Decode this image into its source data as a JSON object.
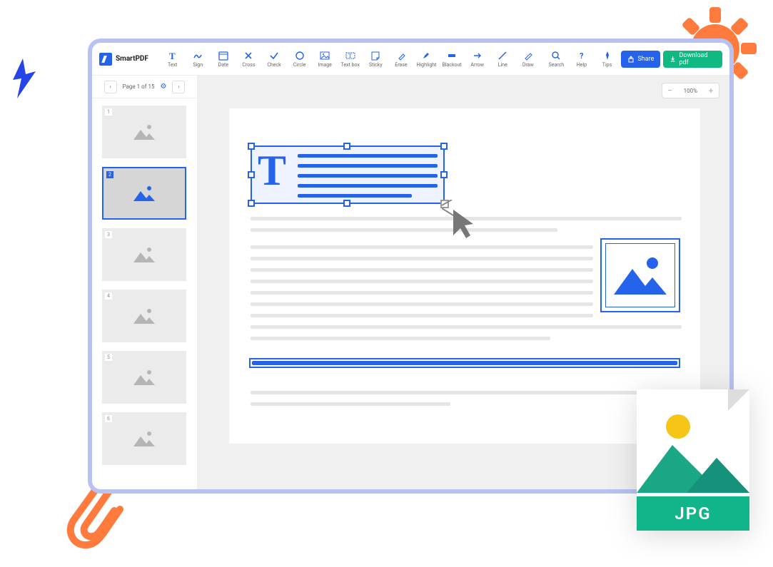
{
  "brand": {
    "name": "SmartPDF"
  },
  "toolbar": {
    "items": [
      {
        "label": "Text"
      },
      {
        "label": "Sign"
      },
      {
        "label": "Date"
      },
      {
        "label": "Cross"
      },
      {
        "label": "Check"
      },
      {
        "label": "Circle"
      },
      {
        "label": "Image"
      },
      {
        "label": "Text box"
      },
      {
        "label": "Sticky"
      },
      {
        "label": "Erase"
      },
      {
        "label": "Highlight"
      },
      {
        "label": "Blackout"
      },
      {
        "label": "Arrow"
      },
      {
        "label": "Line"
      },
      {
        "label": "Draw"
      }
    ],
    "utilities": [
      {
        "label": "Search"
      },
      {
        "label": "Help"
      },
      {
        "label": "Tips"
      }
    ],
    "share_label": "Share",
    "download_label": "Download pdf"
  },
  "sidebar": {
    "pager_label": "Page 1 of 15",
    "thumbs": [
      {
        "n": "1",
        "selected": false
      },
      {
        "n": "2",
        "selected": true
      },
      {
        "n": "3",
        "selected": false
      },
      {
        "n": "4",
        "selected": false
      },
      {
        "n": "5",
        "selected": false
      },
      {
        "n": "6",
        "selected": false
      }
    ]
  },
  "zoom": {
    "value": "100%"
  },
  "jpg": {
    "label": "JPG"
  },
  "editor": {
    "drop_cap": "T"
  }
}
